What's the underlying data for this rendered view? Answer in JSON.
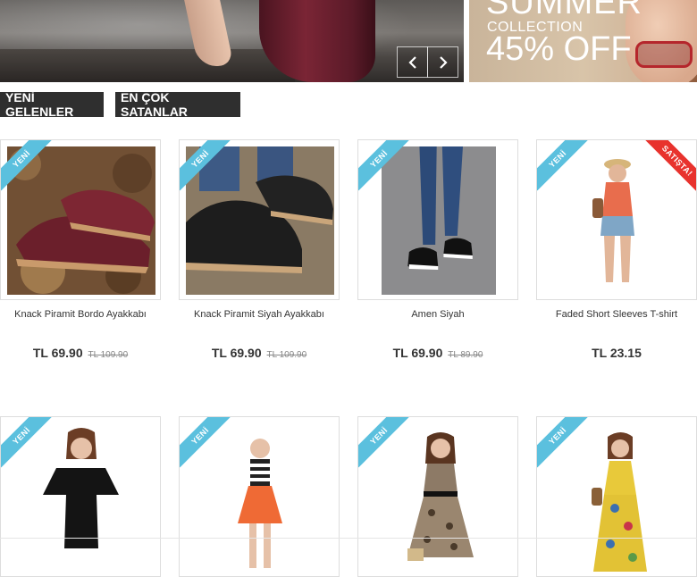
{
  "banner_left": {
    "prev_label": "‹",
    "next_label": "›"
  },
  "banner_right": {
    "title": "SUMMER",
    "subtitle": "COLLECTION",
    "offer": "45% OFF"
  },
  "tabs": [
    {
      "label": "YENİ GELENLER"
    },
    {
      "label": "EN ÇOK SATANLAR"
    }
  ],
  "badges": {
    "new": "YENİ",
    "sale": "SATIŞTA!"
  },
  "products": [
    {
      "name": "Knack Piramit Bordo Ayakkabı",
      "price": "TL 69.90",
      "old_price": "TL 109.90"
    },
    {
      "name": "Knack Piramit Siyah Ayakkabı",
      "price": "TL 69.90",
      "old_price": "TL 109.90"
    },
    {
      "name": "Amen Siyah",
      "price": "TL 69.90",
      "old_price": "TL 89.90"
    },
    {
      "name": "Faded Short Sleeves T-shirt",
      "price": "TL 23.15",
      "old_price": ""
    }
  ],
  "colors": {
    "tab_bg": "#2f2f2f",
    "new_badge": "#5bc0de",
    "sale_badge": "#e8322d"
  }
}
